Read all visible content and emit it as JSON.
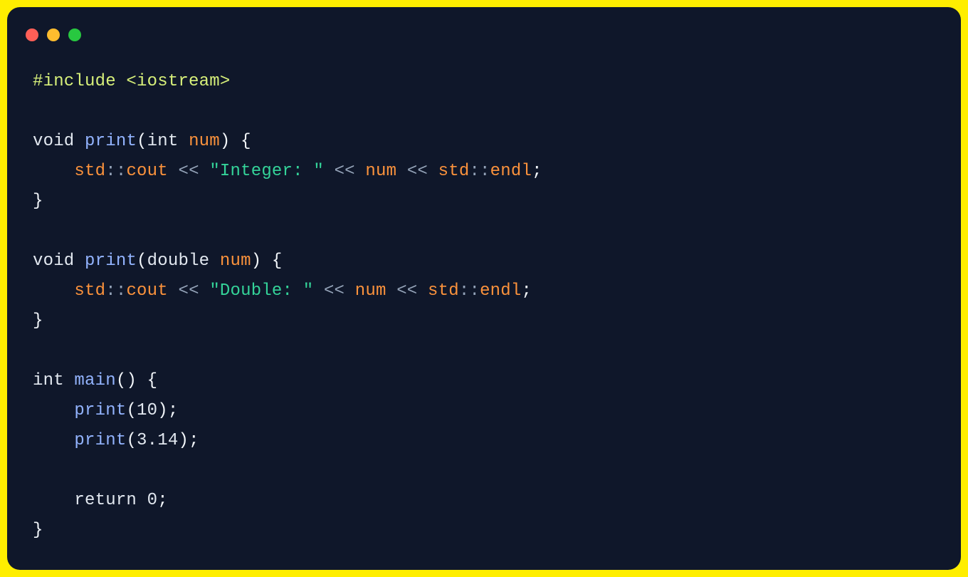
{
  "window": {
    "traffic_lights": {
      "close": "red",
      "minimize": "yellow",
      "zoom": "green"
    }
  },
  "code": {
    "indent": "    ",
    "include_line": "#include <iostream>",
    "t": {
      "void": "void",
      "int": "int",
      "double": "double",
      "return": "return",
      "print": "print",
      "main": "main",
      "std": "std",
      "cout": "cout",
      "endl": "endl",
      "num": "num",
      "dblcolon": "::",
      "shl": "<<",
      "lparen": "(",
      "rparen": ")",
      "lbrace": "{",
      "rbrace": "}",
      "semi": ";",
      "space": " "
    },
    "str_integer": "\"Integer: \"",
    "str_double": "\"Double: \"",
    "num_10": "10",
    "num_pi": "3.14",
    "num_0": "0"
  }
}
